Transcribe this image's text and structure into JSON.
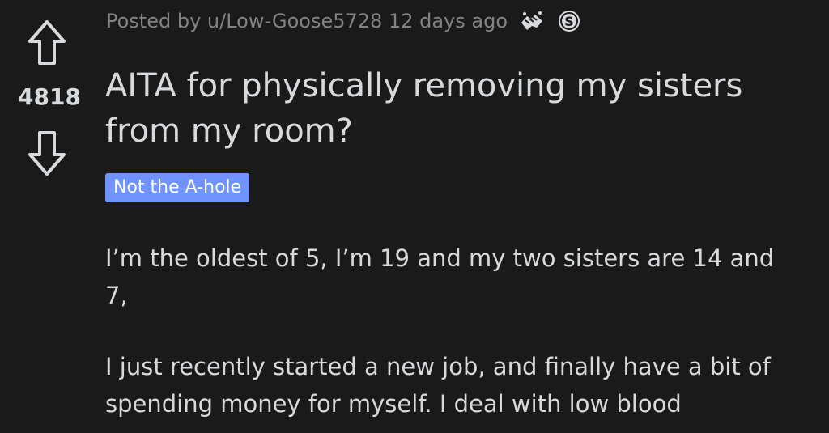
{
  "post": {
    "score": "4818",
    "meta": "Posted by u/Low-Goose5728 12 days ago",
    "title": "AITA for physically removing my sisters from my room?",
    "flair": "Not the A-hole",
    "paragraphs": [
      "I’m the oldest of 5, I’m 19 and my two sisters are 14 and 7,",
      "I just recently started a new job, and finally have a bit of spending money for myself. I deal with low blood"
    ],
    "icons": {
      "upvote": "upvote-arrow-icon",
      "downvote": "downvote-arrow-icon",
      "award1": "handshake-award-icon",
      "award2": "silver-award-icon"
    }
  },
  "colors": {
    "background": "#1a1a1b",
    "text": "#d7dadc",
    "meta": "#818384",
    "flair_bg": "#7193ff",
    "flair_text": "#ffffff"
  }
}
